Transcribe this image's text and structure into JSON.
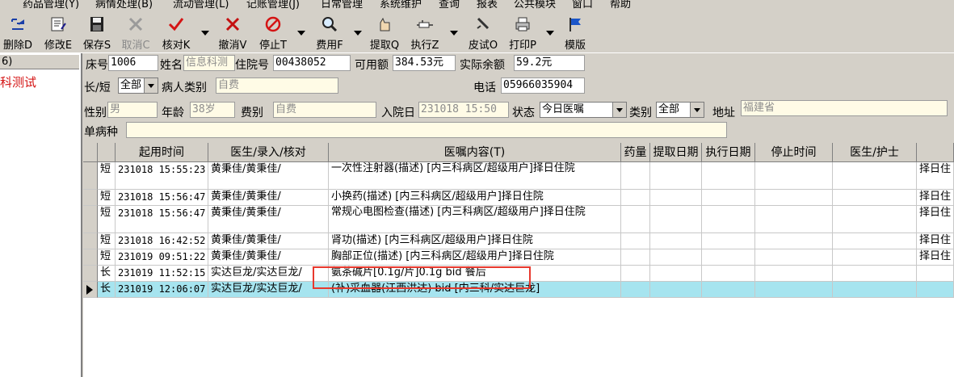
{
  "menu": [
    "药品管理(Y)",
    "病情处理(B)",
    "流动管理(L)",
    "记账管理(J)",
    "日常管理",
    "系统维护",
    "查询",
    "报表",
    "公共模块",
    "窗口",
    "帮助"
  ],
  "toolbar": {
    "delete": "删除D",
    "modify": "修改E",
    "save": "保存S",
    "cancel": "取消C",
    "check": "核对K",
    "revoke": "撤消V",
    "stop": "停止T",
    "fee": "费用F",
    "fetch": "提取Q",
    "execute": "执行Z",
    "skintest": "皮试O",
    "print": "打印P",
    "template": "模版"
  },
  "left_panel": {
    "header": "6)",
    "item": "科测试"
  },
  "patient": {
    "bed_label": "床号",
    "bed": "1006",
    "name_label": "姓名",
    "name": "信息科测",
    "admission_label": "住院号",
    "admission_no": "00438052",
    "available_label": "可用额",
    "available": "384.53元",
    "balance_label": "实际余额",
    "balance": "59.2元",
    "term_label": "长/短",
    "term": "全部",
    "category_label": "病人类别",
    "category": "自费",
    "phone_label": "电话",
    "phone": "05966035904",
    "sex_label": "性别",
    "sex": "男",
    "age_label": "年龄",
    "age": "38岁",
    "feetype_label": "费别",
    "feetype": "自费",
    "admit_date_label": "入院日",
    "admit_date": "231018 15:50",
    "status_label": "状态",
    "status": "今日医嘱",
    "type_label": "类别",
    "type": "全部",
    "address_label": "地址",
    "address": "福建省",
    "disease_label": "单病种",
    "disease": ""
  },
  "grid": {
    "headers": [
      "起用时间",
      "医生/录入/核对",
      "医嘱内容(T)",
      "药量",
      "提取日期",
      "执行日期",
      "停止时间",
      "医生/护士",
      ""
    ],
    "rows": [
      {
        "kind": "短",
        "time": "231018 15:55:23",
        "doctor": "黄秉佳/黄秉佳/",
        "content": "一次性注射器(描述)  [内三科病区/超级用户]择日住院",
        "tail": "择日住"
      },
      {
        "kind": "短",
        "time": "231018 15:56:47",
        "doctor": "黄秉佳/黄秉佳/",
        "content": "小换药(描述)  [内三科病区/超级用户]择日住院",
        "tail": "择日住"
      },
      {
        "kind": "短",
        "time": "231018 15:56:47",
        "doctor": "黄秉佳/黄秉佳/",
        "content": "常规心电图检查(描述)  [内三科病区/超级用户]择日住院",
        "tail": "择日住"
      },
      {
        "kind": "短",
        "time": "231018 16:42:52",
        "doctor": "黄秉佳/黄秉佳/",
        "content": "肾功(描述)  [内三科病区/超级用户]择日住院",
        "tail": "择日住"
      },
      {
        "kind": "短",
        "time": "231019 09:51:22",
        "doctor": "黄秉佳/黄秉佳/",
        "content": "胸部正位(描述)  [内三科病区/超级用户]择日住院",
        "tail": "择日住"
      },
      {
        "kind": "长",
        "time": "231019 11:52:15",
        "doctor": "实达巨龙/实达巨龙/",
        "content": "氨茶碱片[0.1g/片]0.1g bid 餐后",
        "tail": ""
      },
      {
        "kind": "长",
        "time": "231019 12:06:07",
        "doctor": "实达巨龙/实达巨龙/",
        "content": "(补)采血器(江西洪达) bid [内三科/实达巨龙]",
        "tail": ""
      }
    ]
  },
  "colors": {
    "selected_row": "#a6e4ef",
    "highlight_box": "#e8392e"
  }
}
